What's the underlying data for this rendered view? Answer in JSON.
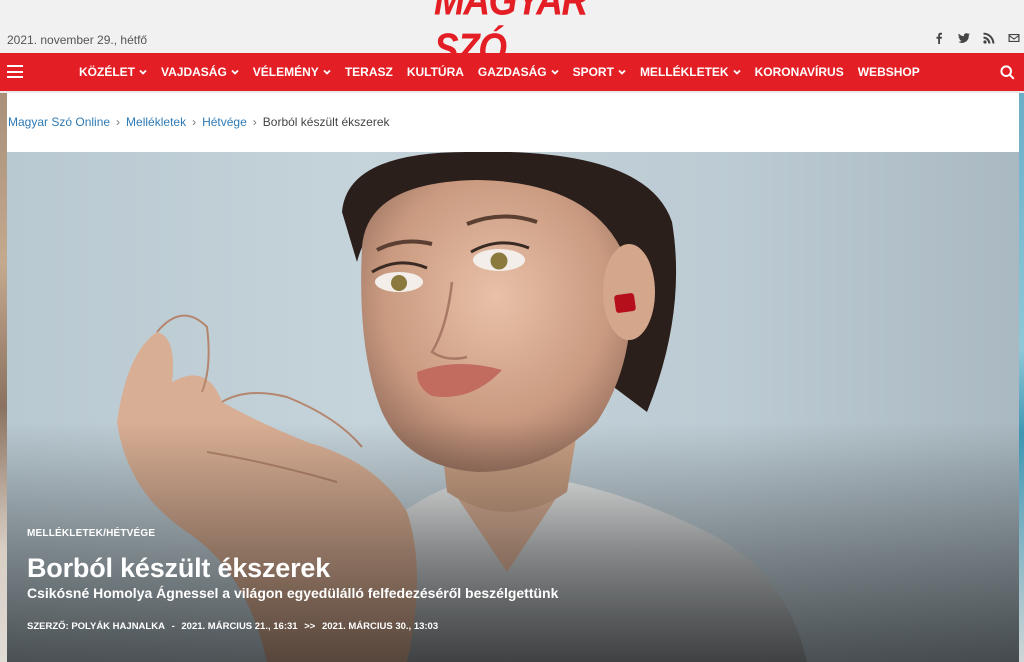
{
  "header": {
    "date": "2021. november 29., hétfő",
    "logo_text": "Magyar Szó",
    "social_icons": [
      "facebook-icon",
      "twitter-icon",
      "rss-icon",
      "email-icon"
    ]
  },
  "nav": {
    "items": [
      {
        "label": "KÖZÉLET",
        "dropdown": true
      },
      {
        "label": "VAJDASÁG",
        "dropdown": true
      },
      {
        "label": "VÉLEMÉNY",
        "dropdown": true
      },
      {
        "label": "TERASZ",
        "dropdown": false
      },
      {
        "label": "KULTÚRA",
        "dropdown": false
      },
      {
        "label": "GAZDASÁG",
        "dropdown": true
      },
      {
        "label": "SPORT",
        "dropdown": true
      },
      {
        "label": "MELLÉKLETEK",
        "dropdown": true
      },
      {
        "label": "KORONAVÍRUS",
        "dropdown": false
      },
      {
        "label": "WEBSHOP",
        "dropdown": false
      }
    ],
    "brand_color": "#e31e24"
  },
  "breadcrumb": {
    "items": [
      "Magyar Szó Online",
      "Mellékletek",
      "Hétvége"
    ],
    "current": "Borból készült ékszerek"
  },
  "article": {
    "category": "MELLÉKLETEK/HÉTVÉGE",
    "title": "Borból készült ékszerek",
    "subtitle": "Csikósné Homolya Ágnessel a világon egyedülálló felfedezéséről beszélgettünk",
    "author": "SZERZŐ: POLYÁK HAJNALKA",
    "separator": "-",
    "published": "2021. MÁRCIUS 21., 16:31",
    "arrow": ">>",
    "updated": "2021. MÁRCIUS 30., 13:03"
  }
}
